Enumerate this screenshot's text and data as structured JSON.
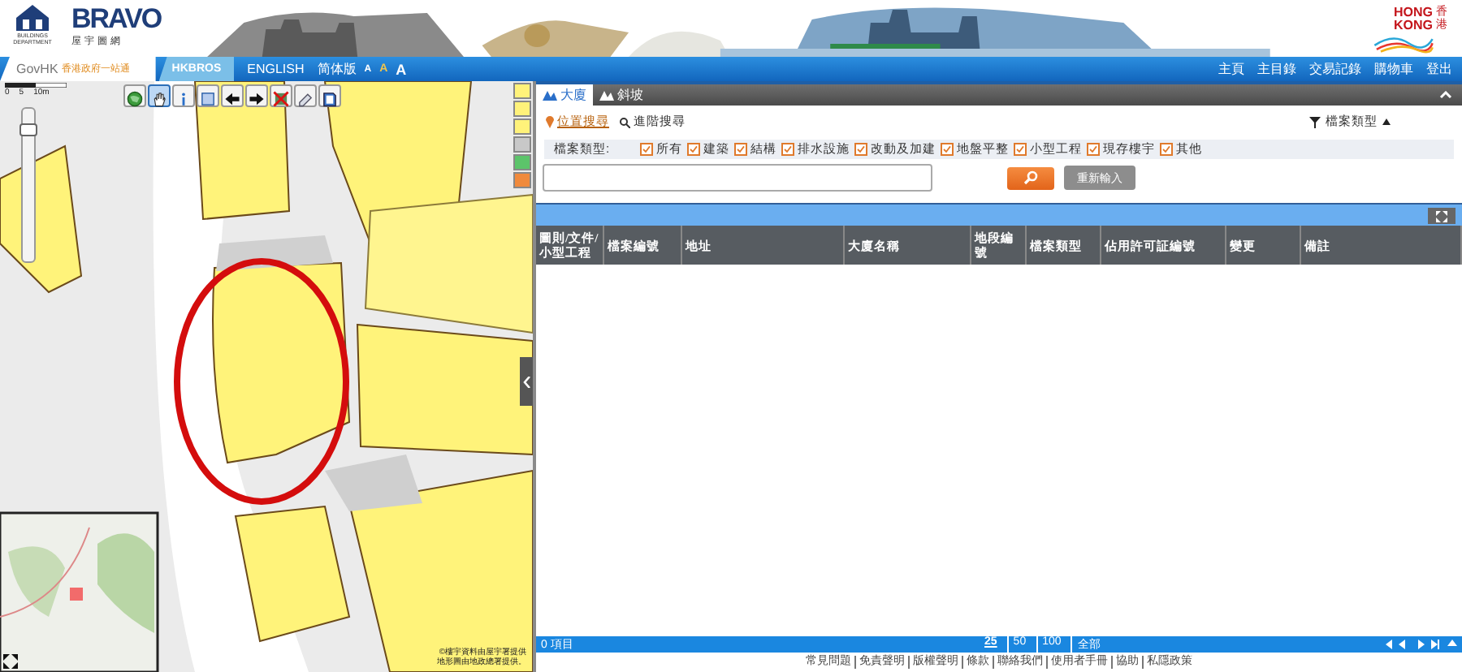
{
  "header": {
    "logo_caption": "BUILDINGS DEPARTMENT",
    "brand": "BRAVO",
    "brand_caption": "屋宇圖網",
    "hk_logo": "HONG KONG",
    "hk_logo_caption": "香港"
  },
  "nav": {
    "govhk": "GovHK",
    "govhk_caption": "香港政府一站通",
    "tab": "HKBROS",
    "languages": [
      "ENGLISH",
      "简体版"
    ],
    "font_sizes": [
      "A",
      "A",
      "A"
    ],
    "links": [
      "主頁",
      "主目錄",
      "交易記錄",
      "購物車",
      "登出"
    ]
  },
  "map": {
    "tools": [
      {
        "kind": "globe",
        "selected": false
      },
      {
        "kind": "pan",
        "selected": true
      },
      {
        "kind": "info",
        "selected": false
      },
      {
        "kind": "box",
        "selected": false
      },
      {
        "kind": "back",
        "selected": false
      },
      {
        "kind": "forward",
        "selected": false
      },
      {
        "kind": "clear",
        "selected": false
      },
      {
        "kind": "eraser",
        "selected": false
      },
      {
        "kind": "book",
        "selected": false
      }
    ],
    "scale": [
      "0",
      "5",
      "10m"
    ],
    "zoom": {
      "level": 0.9
    },
    "legend": [
      {
        "color": "#fff27a"
      },
      {
        "color": "#fff27a"
      },
      {
        "color": "#fff27a"
      },
      {
        "color": "#c8c8c8"
      },
      {
        "color": "#5cc46a"
      },
      {
        "color": "#f08a3c"
      }
    ],
    "copyright": [
      "©樓宇資料由屋宇署提供",
      "地形圖由地政總署提供。"
    ]
  },
  "panel": {
    "tabs": [
      {
        "label": "大廈",
        "selected": true
      },
      {
        "label": "斜坡",
        "selected": false
      }
    ],
    "search_modes": [
      {
        "label": "位置搜尋",
        "selected": true
      },
      {
        "label": "進階搜尋",
        "selected": false
      }
    ],
    "filter_toggle": "檔案類型",
    "file_types": {
      "label": "檔案類型:",
      "options": [
        {
          "label": "所有",
          "checked": true
        },
        {
          "label": "建築",
          "checked": true
        },
        {
          "label": "結構",
          "checked": true
        },
        {
          "label": "排水設施",
          "checked": true
        },
        {
          "label": "改動及加建",
          "checked": true
        },
        {
          "label": "地盤平整",
          "checked": true
        },
        {
          "label": "小型工程",
          "checked": true
        },
        {
          "label": "現存樓宇",
          "checked": true
        },
        {
          "label": "其他",
          "checked": true
        }
      ]
    },
    "reset_button": "重新輸入"
  },
  "table": {
    "columns": [
      "圖則/文件/小型工程",
      "檔案編號",
      "地址",
      "大廈名稱",
      "地段編號",
      "檔案類型",
      "佔用許可証編號",
      "變更",
      "備註"
    ]
  },
  "footer": {
    "count": "0 項目",
    "page_sizes": [
      {
        "label": "25",
        "selected": true
      },
      {
        "label": "50",
        "selected": false
      },
      {
        "label": "100",
        "selected": false
      },
      {
        "label": "全部",
        "selected": false
      }
    ]
  },
  "links": [
    "常見問題",
    "免責聲明",
    "版權聲明",
    "條款",
    "聯絡我們",
    "使用者手冊",
    "協助",
    "私隱政策"
  ]
}
